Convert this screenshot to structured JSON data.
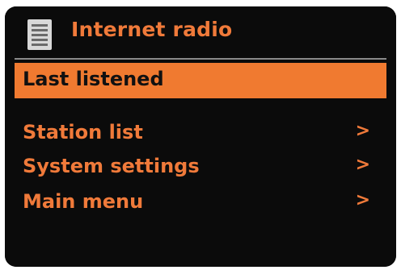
{
  "header": {
    "icon": "list-menu-icon",
    "title": "Internet radio"
  },
  "colors": {
    "accent": "#f07a3a",
    "background": "#0b0b0b",
    "selected_text": "#111111"
  },
  "menu": {
    "items": [
      {
        "label": "Last listened",
        "arrow": "",
        "selected": true
      },
      {
        "label": "Station list",
        "arrow": ">",
        "selected": false
      },
      {
        "label": "System settings",
        "arrow": ">",
        "selected": false
      },
      {
        "label": "Main menu",
        "arrow": ">",
        "selected": false
      }
    ]
  }
}
